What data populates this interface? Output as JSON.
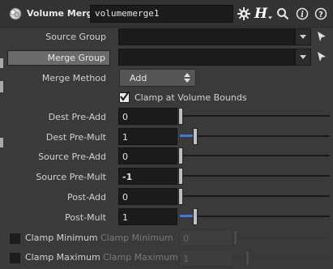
{
  "header": {
    "node_type": "Volume Merge",
    "node_name": "volumemerge1",
    "icons": [
      "volume-merge-node-icon",
      "gear-icon",
      "houdini-help-icon",
      "search-icon",
      "info-icon",
      "help-icon"
    ],
    "h_glyph": "H"
  },
  "params": {
    "source_group": {
      "label": "Source Group",
      "value": ""
    },
    "merge_group": {
      "label": "Merge Group",
      "value": ""
    },
    "merge_method": {
      "label": "Merge Method",
      "value": "Add"
    },
    "clamp_bounds": {
      "label": "Clamp at Volume Bounds",
      "checked": true
    },
    "dest_pre_add": {
      "label": "Dest Pre-Add",
      "value": "0"
    },
    "dest_pre_mult": {
      "label": "Dest Pre-Mult",
      "value": "1"
    },
    "source_pre_add": {
      "label": "Source Pre-Add",
      "value": "0"
    },
    "source_pre_mult": {
      "label": "Source Pre-Mult",
      "value": "-1"
    },
    "post_add": {
      "label": "Post-Add",
      "value": "0"
    },
    "post_mult": {
      "label": "Post-Mult",
      "value": "1"
    },
    "clamp_minimum": {
      "toggle_label": "Clamp Minimum",
      "label": "Clamp Minimum",
      "value": "0",
      "enabled": false
    },
    "clamp_maximum": {
      "toggle_label": "Clamp Maximum",
      "label": "Clamp Maximum",
      "value": "1",
      "enabled": false
    }
  },
  "colors": {
    "accent": "#3b7ad9",
    "background": "#3a3a3a",
    "field": "#1b1b1b"
  }
}
